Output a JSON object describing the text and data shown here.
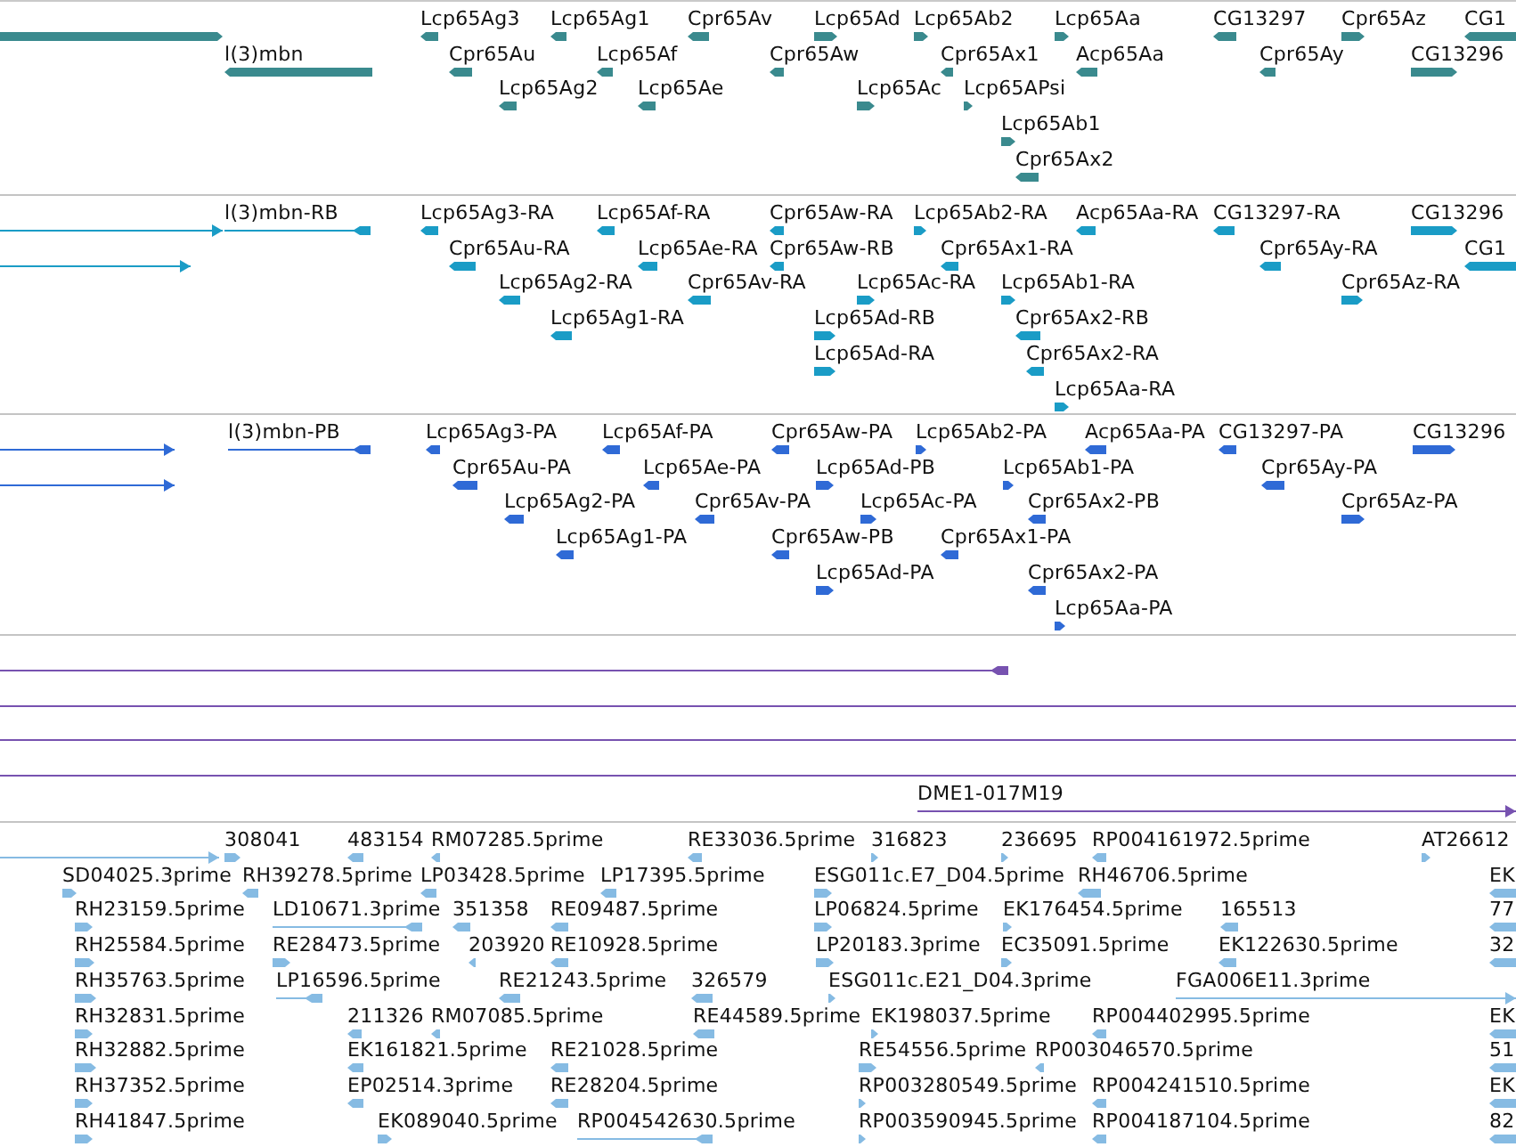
{
  "tracks": [
    {
      "color": "#3a8a8e",
      "features": [
        {
          "kind": "bar"
        },
        {
          "kind": "bar",
          "label": "Lcp65Ag3"
        },
        {
          "kind": "bar",
          "label": "Lcp65Ag1"
        },
        {
          "kind": "bar",
          "label": "Cpr65Av"
        },
        {
          "kind": "bar",
          "label": "Lcp65Ad"
        },
        {
          "kind": "bar",
          "label": "Lcp65Ab2"
        },
        {
          "kind": "bar",
          "label": "Lcp65Aa"
        },
        {
          "kind": "bar",
          "label": "CG13297"
        },
        {
          "kind": "bar",
          "label": "Cpr65Az"
        },
        {
          "kind": "bar",
          "label": "CG1"
        },
        {
          "kind": "bar",
          "label": "l(3)mbn"
        },
        {
          "kind": "bar",
          "label": "Cpr65Au"
        },
        {
          "kind": "bar",
          "label": "Lcp65Af"
        },
        {
          "kind": "bar",
          "label": "Cpr65Aw"
        },
        {
          "kind": "bar",
          "label": "Cpr65Ax1"
        },
        {
          "kind": "bar",
          "label": "Acp65Aa"
        },
        {
          "kind": "bar",
          "label": "Cpr65Ay"
        },
        {
          "kind": "bar",
          "label": "CG13296"
        },
        {
          "kind": "bar",
          "label": "Lcp65Ag2"
        },
        {
          "kind": "bar",
          "label": "Lcp65Ae"
        },
        {
          "kind": "bar",
          "label": "Lcp65Ac"
        },
        {
          "kind": "bar",
          "label": "Lcp65APsi"
        },
        {
          "kind": "bar",
          "label": "Lcp65Ab1"
        },
        {
          "kind": "bar",
          "label": "Cpr65Ax2"
        }
      ]
    },
    {
      "color": "#1a9cc6",
      "features": [
        {
          "kind": "line"
        },
        {
          "kind": "line",
          "label": "l(3)mbn-RB"
        },
        {
          "kind": "bar",
          "label": "Lcp65Ag3-RA"
        },
        {
          "kind": "bar",
          "label": "Lcp65Af-RA"
        },
        {
          "kind": "bar",
          "label": "Cpr65Aw-RA"
        },
        {
          "kind": "bar",
          "label": "Lcp65Ab2-RA"
        },
        {
          "kind": "bar",
          "label": "Acp65Aa-RA"
        },
        {
          "kind": "bar",
          "label": "CG13297-RA"
        },
        {
          "kind": "bar",
          "label": "CG13296"
        },
        {
          "kind": "line"
        },
        {
          "kind": "bar",
          "label": "Cpr65Au-RA"
        },
        {
          "kind": "bar",
          "label": "Lcp65Ae-RA"
        },
        {
          "kind": "bar",
          "label": "Cpr65Aw-RB"
        },
        {
          "kind": "bar",
          "label": "Cpr65Ax1-RA"
        },
        {
          "kind": "bar",
          "label": "Cpr65Ay-RA"
        },
        {
          "kind": "bar",
          "label": "CG1"
        },
        {
          "kind": "bar",
          "label": "Lcp65Ag2-RA"
        },
        {
          "kind": "bar",
          "label": "Cpr65Av-RA"
        },
        {
          "kind": "bar",
          "label": "Lcp65Ac-RA"
        },
        {
          "kind": "bar",
          "label": "Lcp65Ab1-RA"
        },
        {
          "kind": "bar",
          "label": "Cpr65Az-RA"
        },
        {
          "kind": "bar",
          "label": "Lcp65Ag1-RA"
        },
        {
          "kind": "bar",
          "label": "Lcp65Ad-RB"
        },
        {
          "kind": "bar",
          "label": "Cpr65Ax2-RB"
        },
        {
          "kind": "bar",
          "label": "Lcp65Ad-RA"
        },
        {
          "kind": "bar",
          "label": "Cpr65Ax2-RA"
        },
        {
          "kind": "bar",
          "label": "Lcp65Aa-RA"
        }
      ]
    },
    {
      "color": "#2f6ad6",
      "features": [
        {
          "kind": "line"
        },
        {
          "kind": "line",
          "label": "l(3)mbn-PB"
        },
        {
          "kind": "bar",
          "label": "Lcp65Ag3-PA"
        },
        {
          "kind": "bar",
          "label": "Lcp65Af-PA"
        },
        {
          "kind": "bar",
          "label": "Cpr65Aw-PA"
        },
        {
          "kind": "bar",
          "label": "Lcp65Ab2-PA"
        },
        {
          "kind": "bar",
          "label": "Acp65Aa-PA"
        },
        {
          "kind": "bar",
          "label": "CG13297-PA"
        },
        {
          "kind": "bar",
          "label": "CG13296"
        },
        {
          "kind": "line"
        },
        {
          "kind": "bar",
          "label": "Cpr65Au-PA"
        },
        {
          "kind": "bar",
          "label": "Lcp65Ae-PA"
        },
        {
          "kind": "bar",
          "label": "Lcp65Ad-PB"
        },
        {
          "kind": "bar",
          "label": "Lcp65Ab1-PA"
        },
        {
          "kind": "bar",
          "label": "Cpr65Ay-PA"
        },
        {
          "kind": "bar",
          "label": "Lcp65Ag2-PA"
        },
        {
          "kind": "bar",
          "label": "Cpr65Av-PA"
        },
        {
          "kind": "bar",
          "label": "Lcp65Ac-PA"
        },
        {
          "kind": "bar",
          "label": "Cpr65Ax2-PB"
        },
        {
          "kind": "bar",
          "label": "Cpr65Az-PA"
        },
        {
          "kind": "bar",
          "label": "Lcp65Ag1-PA"
        },
        {
          "kind": "bar",
          "label": "Cpr65Aw-PB"
        },
        {
          "kind": "bar",
          "label": "Cpr65Ax1-PA"
        },
        {
          "kind": "bar",
          "label": "Lcp65Ad-PA"
        },
        {
          "kind": "bar",
          "label": "Cpr65Ax2-PA"
        },
        {
          "kind": "bar",
          "label": "Lcp65Aa-PA"
        }
      ]
    },
    {
      "color": "#7752b0",
      "features": [
        {
          "kind": "line"
        },
        {
          "kind": "line"
        },
        {
          "kind": "line"
        },
        {
          "kind": "line"
        },
        {
          "kind": "line",
          "label": "DME1-017M19"
        }
      ]
    },
    {
      "color": "#86bbe3",
      "features": [
        {
          "kind": "line"
        },
        {
          "kind": "bar",
          "label": "308041"
        },
        {
          "kind": "bar",
          "label": "483154"
        },
        {
          "kind": "bar",
          "label": "RM07285.5prime"
        },
        {
          "kind": "bar",
          "label": "RE33036.5prime"
        },
        {
          "kind": "bar",
          "label": "316823"
        },
        {
          "kind": "bar",
          "label": "236695"
        },
        {
          "kind": "bar",
          "label": "RP004161972.5prime"
        },
        {
          "kind": "bar",
          "label": "AT26612"
        },
        {
          "kind": "bar",
          "label": "SD04025.3prime"
        },
        {
          "kind": "bar",
          "label": "RH39278.5prime"
        },
        {
          "kind": "bar",
          "label": "LP03428.5prime"
        },
        {
          "kind": "bar",
          "label": "LP17395.5prime"
        },
        {
          "kind": "bar",
          "label": "ESG011c.E7_D04.5prime"
        },
        {
          "kind": "bar",
          "label": "RH46706.5prime"
        },
        {
          "kind": "bar",
          "label": "EK"
        },
        {
          "kind": "bar",
          "label": "RH23159.5prime"
        },
        {
          "kind": "line",
          "label": "LD10671.3prime"
        },
        {
          "kind": "bar",
          "label": "351358"
        },
        {
          "kind": "bar",
          "label": "RE09487.5prime"
        },
        {
          "kind": "bar",
          "label": "LP06824.5prime"
        },
        {
          "kind": "bar",
          "label": "EK176454.5prime"
        },
        {
          "kind": "bar",
          "label": "165513"
        },
        {
          "kind": "bar",
          "label": "77"
        },
        {
          "kind": "bar",
          "label": "RH25584.5prime"
        },
        {
          "kind": "bar",
          "label": "RE28473.5prime"
        },
        {
          "kind": "bar",
          "label": "203920"
        },
        {
          "kind": "bar",
          "label": "RE10928.5prime"
        },
        {
          "kind": "bar",
          "label": "LP20183.3prime"
        },
        {
          "kind": "bar",
          "label": "EC35091.5prime"
        },
        {
          "kind": "bar",
          "label": "EK122630.5prime"
        },
        {
          "kind": "bar",
          "label": "32"
        },
        {
          "kind": "bar",
          "label": "RH35763.5prime"
        },
        {
          "kind": "line",
          "label": "LP16596.5prime"
        },
        {
          "kind": "bar",
          "label": "RE21243.5prime"
        },
        {
          "kind": "bar",
          "label": "326579"
        },
        {
          "kind": "bar",
          "label": "ESG011c.E21_D04.3prime"
        },
        {
          "kind": "line",
          "label": "FGA006E11.3prime"
        },
        {
          "kind": "bar",
          "label": "RH32831.5prime"
        },
        {
          "kind": "bar",
          "label": "211326"
        },
        {
          "kind": "bar",
          "label": "RM07085.5prime"
        },
        {
          "kind": "bar",
          "label": "RE44589.5prime"
        },
        {
          "kind": "bar",
          "label": "EK198037.5prime"
        },
        {
          "kind": "bar",
          "label": "RP004402995.5prime"
        },
        {
          "kind": "bar",
          "label": "EK"
        },
        {
          "kind": "bar",
          "label": "RH32882.5prime"
        },
        {
          "kind": "bar",
          "label": "EK161821.5prime"
        },
        {
          "kind": "bar",
          "label": "RE21028.5prime"
        },
        {
          "kind": "bar",
          "label": "RE54556.5prime"
        },
        {
          "kind": "bar",
          "label": "RP003046570.5prime"
        },
        {
          "kind": "bar",
          "label": "51"
        },
        {
          "kind": "bar",
          "label": "RH37352.5prime"
        },
        {
          "kind": "bar",
          "label": "EP02514.3prime"
        },
        {
          "kind": "bar",
          "label": "RE28204.5prime"
        },
        {
          "kind": "bar",
          "label": "RP003280549.5prime"
        },
        {
          "kind": "bar",
          "label": "RP004241510.5prime"
        },
        {
          "kind": "bar",
          "label": "EK"
        },
        {
          "kind": "bar",
          "label": "RH41847.5prime"
        },
        {
          "kind": "bar",
          "label": "EK089040.5prime"
        },
        {
          "kind": "line",
          "label": "RP004542630.5prime"
        },
        {
          "kind": "bar",
          "label": "RP003590945.5prime"
        },
        {
          "kind": "bar",
          "label": "RP004187104.5prime"
        },
        {
          "kind": "bar",
          "label": "82"
        }
      ]
    }
  ]
}
